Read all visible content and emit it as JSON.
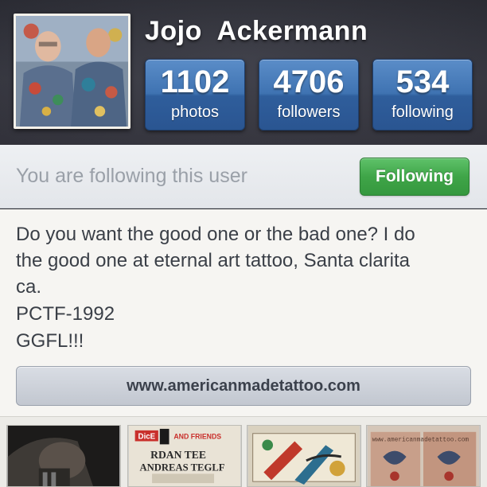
{
  "profile": {
    "username": "Jojo  Ackermann",
    "avatar_icon": "profile-photo"
  },
  "stats": [
    {
      "value": "1102",
      "label": "photos"
    },
    {
      "value": "4706",
      "label": "followers"
    },
    {
      "value": "534",
      "label": "following"
    }
  ],
  "follow": {
    "status_text": "You are following this user",
    "button_label": "Following",
    "button_color": "#3fa548"
  },
  "bio": {
    "lines": [
      "Do you want the good one or the bad one? I do",
      "the good one at eternal art tattoo, Santa clarita",
      "ca.",
      "PCTF-1992",
      "GGFL!!!"
    ]
  },
  "website": {
    "label": "www.americanmadetattoo.com"
  },
  "thumbnails": {
    "t2_text_top": "DicE",
    "t2_text_top2": "AND FRIENDS",
    "t2_text_mid": "RDAN TEE",
    "t2_text_mid2": "ANDREAS TEGLF",
    "t4_text": "www.americanmadetattoo.com"
  },
  "colors": {
    "header_bg": "#3a3a44",
    "stat_blue": "#3f73b2",
    "follow_green": "#3fa548"
  }
}
